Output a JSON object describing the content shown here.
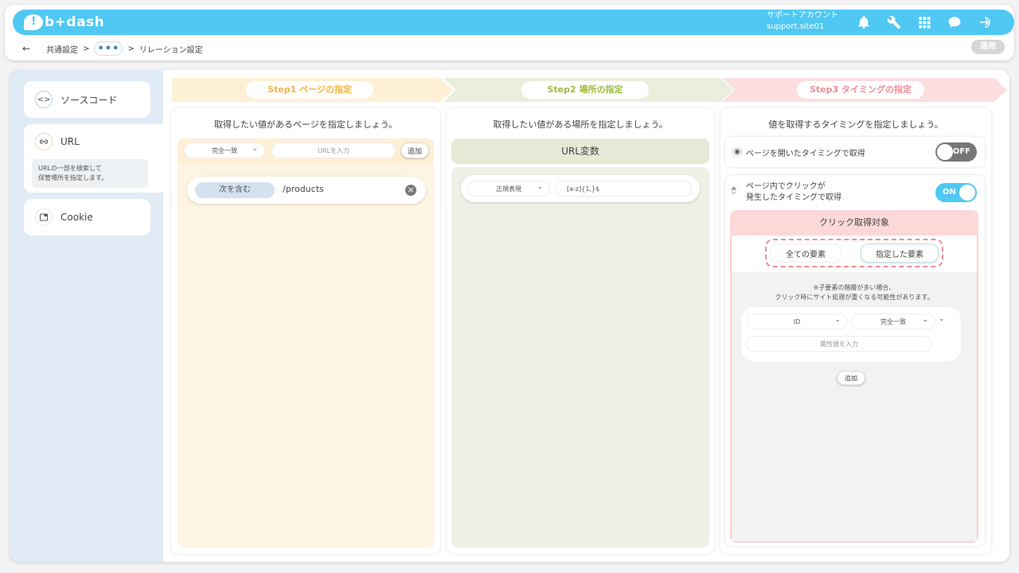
{
  "app": {
    "brand": "b+dash"
  },
  "account": {
    "label": "サポートアカウント",
    "site": "support.site01"
  },
  "breadcrumb": {
    "back": "←",
    "item1": "共通設定",
    "sep": ">",
    "dots": "•••",
    "item3": "リレーション設定"
  },
  "apply_label": "適用",
  "sidebar": {
    "source_label": "ソースコード",
    "url_label": "URL",
    "url_desc_1": "URLの一部を検索して",
    "url_desc_2": "保管場所を指定します。",
    "cookie_label": "Cookie"
  },
  "steps": [
    {
      "label": "Step1 ページの指定",
      "color": "#f5b43c"
    },
    {
      "label": "Step2 場所の指定",
      "color": "#9cbc3c"
    },
    {
      "label": "Step3 タイミングの指定",
      "color": "#f08c96"
    }
  ],
  "col1": {
    "title": "取得したい値があるページを指定しましょう。",
    "match_select": "完全一致",
    "url_placeholder": "URLを入力",
    "add_label": "追加",
    "cond_chip": "次を含む",
    "cond_value": "/products",
    "remove_icon": "×"
  },
  "col2": {
    "title": "取得したい値がある場所を指定しましょう。",
    "section_label": "URL変数",
    "regex_select": "正規表現",
    "regex_value": "[a-z]{1,}$"
  },
  "col3": {
    "title": "値を取得するタイミングを指定しましょう。",
    "open_timing_label": "ページを開いたタイミングで取得",
    "open_toggle": "OFF",
    "click_timing_line1": "ページ内でクリックが",
    "click_timing_line2": "発生したタイミングで取得",
    "click_toggle": "ON",
    "click_target_label": "クリック取得対象",
    "all_elements": "全ての要素",
    "specified_elements": "指定した要素",
    "note_line1": "※子要素の階層が多い場合、",
    "note_line2": "クリック時にサイト処理が重くなる可能性があります。",
    "attr_select": "ID",
    "match_select": "完全一致",
    "attr_placeholder": "属性値を入力",
    "add_label": "追加"
  }
}
